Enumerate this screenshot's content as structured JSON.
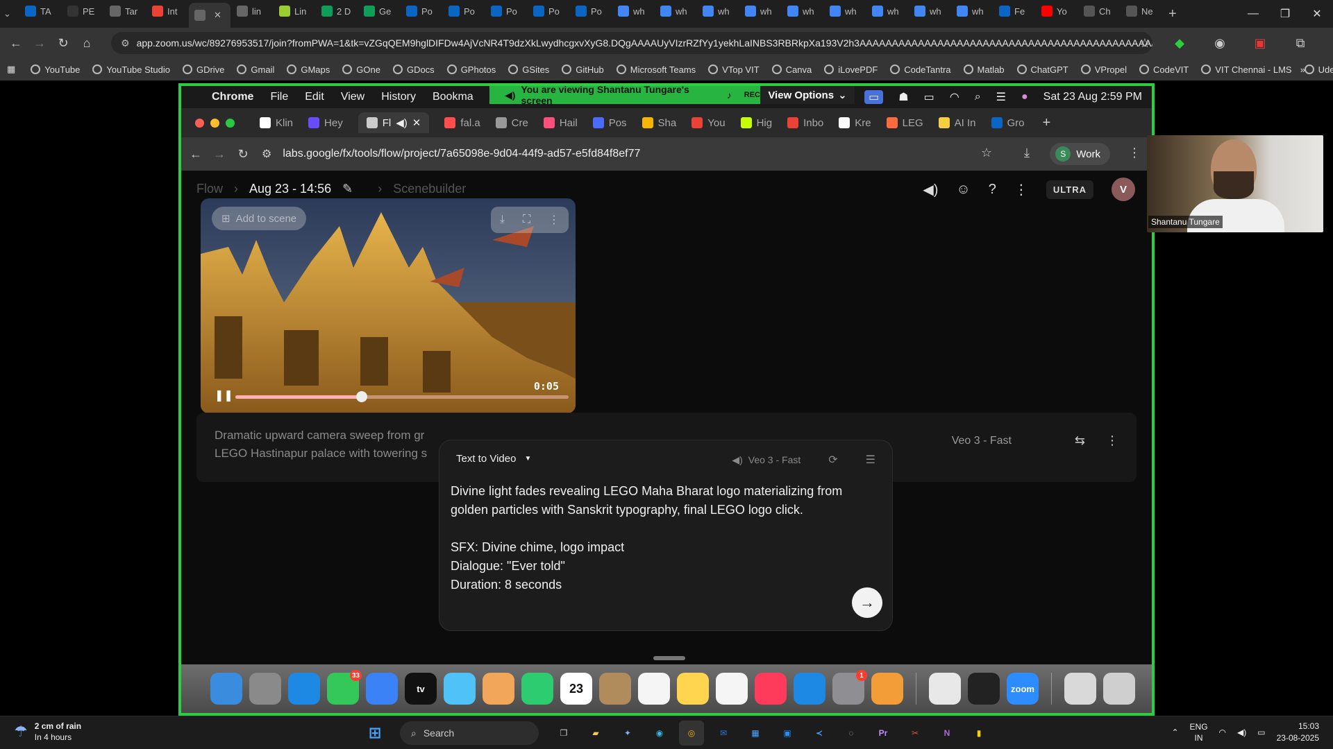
{
  "browser": {
    "tabs": [
      {
        "label": "TA",
        "icon": "linkedin-icon",
        "color": "#0a66c2"
      },
      {
        "label": "PE",
        "icon": "github-icon",
        "color": "#333333"
      },
      {
        "label": "Tar",
        "icon": "globe-icon",
        "color": "#666666"
      },
      {
        "label": "Int",
        "icon": "gmail-icon",
        "color": "#ea4335"
      },
      {
        "label": "",
        "icon": "zoom-audio-icon",
        "color": "#666666",
        "active": true
      },
      {
        "label": "lin",
        "icon": "globe-icon",
        "color": "#666666"
      },
      {
        "label": "Lin",
        "icon": "dots-icon",
        "color": "#9acd32"
      },
      {
        "label": "2 D",
        "icon": "sheets-icon",
        "color": "#0f9d58"
      },
      {
        "label": "Ge",
        "icon": "sheets-icon",
        "color": "#0f9d58"
      },
      {
        "label": "Po",
        "icon": "linkedin-icon",
        "color": "#0a66c2"
      },
      {
        "label": "Po",
        "icon": "linkedin-icon",
        "color": "#0a66c2"
      },
      {
        "label": "Po",
        "icon": "linkedin-icon",
        "color": "#0a66c2"
      },
      {
        "label": "Po",
        "icon": "linkedin-icon",
        "color": "#0a66c2"
      },
      {
        "label": "Po",
        "icon": "linkedin-icon",
        "color": "#0a66c2"
      },
      {
        "label": "wh",
        "icon": "google-icon",
        "color": "#4285f4"
      },
      {
        "label": "wh",
        "icon": "google-icon",
        "color": "#4285f4"
      },
      {
        "label": "wh",
        "icon": "google-icon",
        "color": "#4285f4"
      },
      {
        "label": "wh",
        "icon": "google-icon",
        "color": "#4285f4"
      },
      {
        "label": "wh",
        "icon": "google-icon",
        "color": "#4285f4"
      },
      {
        "label": "wh",
        "icon": "google-icon",
        "color": "#4285f4"
      },
      {
        "label": "wh",
        "icon": "google-icon",
        "color": "#4285f4"
      },
      {
        "label": "wh",
        "icon": "google-icon",
        "color": "#4285f4"
      },
      {
        "label": "wh",
        "icon": "google-icon",
        "color": "#4285f4"
      },
      {
        "label": "Fe",
        "icon": "linkedin-icon",
        "color": "#0a66c2"
      },
      {
        "label": "Yo",
        "icon": "youtube-icon",
        "color": "#ff0000"
      },
      {
        "label": "Ch",
        "icon": "openai-icon",
        "color": "#555555"
      },
      {
        "label": "Ne",
        "icon": "openai-icon",
        "color": "#555555"
      }
    ],
    "url": "app.zoom.us/wc/89276953517/join?fromPWA=1&tk=vZGqQEM9hglDIFDw4AjVcNR4T9dzXkLwydhcgxvXyG8.DQgAAAAUyVIzrRZfYy1yekhLaINBS3RBRkpXa193V2h3AAAAAAAAAAAAAAAAAAAAAAAAAAAAAAAAAAAAAAAAAAAAAAA&_x_zm_r...",
    "bookmarks": [
      "YouTube",
      "YouTube Studio",
      "GDrive",
      "Gmail",
      "GMaps",
      "GOne",
      "GDocs",
      "GPhotos",
      "GSites",
      "GitHub",
      "Microsoft Teams",
      "VTop VIT",
      "Canva",
      "iLovePDF",
      "CodeTantra",
      "Matlab",
      "ChatGPT",
      "VPropel",
      "CodeVIT",
      "VIT Chennai - LMS",
      "Udemy"
    ]
  },
  "zoom": {
    "banner": "You are viewing Shantanu Tungare's screen",
    "rec": "REC",
    "view_options": "View Options",
    "presenter_name": "Shantanu Tungare"
  },
  "mac": {
    "menus": [
      "Chrome",
      "File",
      "Edit",
      "View",
      "History",
      "Bookma"
    ],
    "clock": "Sat 23 Aug  2:59 PM",
    "tabs": [
      {
        "label": "Klin",
        "color": "#ffffff"
      },
      {
        "label": "Hey",
        "color": "#6a4cff"
      },
      {
        "label": "Fl",
        "color": "#cccccc",
        "active": true
      },
      {
        "label": "fal.a",
        "color": "#ff4d4d"
      },
      {
        "label": "Cre",
        "color": "#999999"
      },
      {
        "label": "Hail",
        "color": "#ff4f7b"
      },
      {
        "label": "Pos",
        "color": "#4b6bff"
      },
      {
        "label": "Sha",
        "color": "#f7b500"
      },
      {
        "label": "You",
        "color": "#ea4335"
      },
      {
        "label": "Hig",
        "color": "#c8ff00"
      },
      {
        "label": "Inbo",
        "color": "#ea4335"
      },
      {
        "label": "Kre",
        "color": "#ffffff"
      },
      {
        "label": "LEG",
        "color": "#ff6b3d"
      },
      {
        "label": "AI In",
        "color": "#f5d142"
      },
      {
        "label": "Gro",
        "color": "#0a66c2"
      }
    ],
    "url": "labs.google/fx/tools/flow/project/7a65098e-9d04-44f9-ad57-e5fd84f8ef77",
    "profile": "Work",
    "profile_initial": "S"
  },
  "flow": {
    "breadcrumb": [
      "Flow",
      "Aug 23 - 14:56",
      "Scenebuilder"
    ],
    "plan": "ULTRA",
    "user_initial": "V",
    "video": {
      "add_to_scene": "Add to scene",
      "time": "0:05",
      "progress": 0.38
    },
    "prompt_preview": "Dramatic upward camera sweep from gr LEGO Hastinapur palace with towering s",
    "prompt_model": "Veo 3 - Fast",
    "composer": {
      "mode": "Text to Video",
      "model": "Veo 3 - Fast",
      "text": "Divine light fades revealing LEGO Maha Bharat logo materializing from golden particles with Sanskrit typography, final LEGO logo click.\n\nSFX: Divine chime, logo impact\nDialogue: \"Ever told\"\nDuration: 8 seconds"
    }
  },
  "dock": {
    "apps": [
      {
        "name": "Finder",
        "color": "#3a8dde"
      },
      {
        "name": "Launchpad",
        "color": "#8a8a8a"
      },
      {
        "name": "Safari",
        "color": "#1e88e5"
      },
      {
        "name": "Messages",
        "color": "#34c759",
        "badge": "33"
      },
      {
        "name": "Mail",
        "color": "#3b82f6"
      },
      {
        "name": "tv",
        "color": "#111111"
      },
      {
        "name": "Maps",
        "color": "#4fc3f7"
      },
      {
        "name": "Photos",
        "color": "#f2a65a"
      },
      {
        "name": "FaceTime",
        "color": "#2ecc71"
      },
      {
        "name": "23",
        "color": "#ffffff",
        "sub": "AUG"
      },
      {
        "name": "Contacts",
        "color": "#b08b5c"
      },
      {
        "name": "Reminders",
        "color": "#f5f5f5"
      },
      {
        "name": "Notes",
        "color": "#ffd54f"
      },
      {
        "name": "Freeform",
        "color": "#f5f5f5"
      },
      {
        "name": "Music",
        "color": "#ff3b5c"
      },
      {
        "name": "App Store",
        "color": "#1e88e5"
      },
      {
        "name": "Settings",
        "color": "#8e8e93",
        "badge": "1"
      },
      {
        "name": "Pages",
        "color": "#f29d38"
      },
      {
        "name": "Chrome",
        "color": "#e8e8e8"
      },
      {
        "name": "Stats",
        "color": "#222222"
      },
      {
        "name": "zoom",
        "color": "#2d8cff"
      },
      {
        "name": "Downloads",
        "color": "#d9d9d9"
      },
      {
        "name": "Trash",
        "color": "#cfcfcf"
      }
    ]
  },
  "taskbar": {
    "weather_line1": "2 cm of rain",
    "weather_line2": "In 4 hours",
    "search": "Search",
    "lang1": "ENG",
    "lang2": "IN",
    "time": "15:03",
    "date": "23-08-2025"
  }
}
